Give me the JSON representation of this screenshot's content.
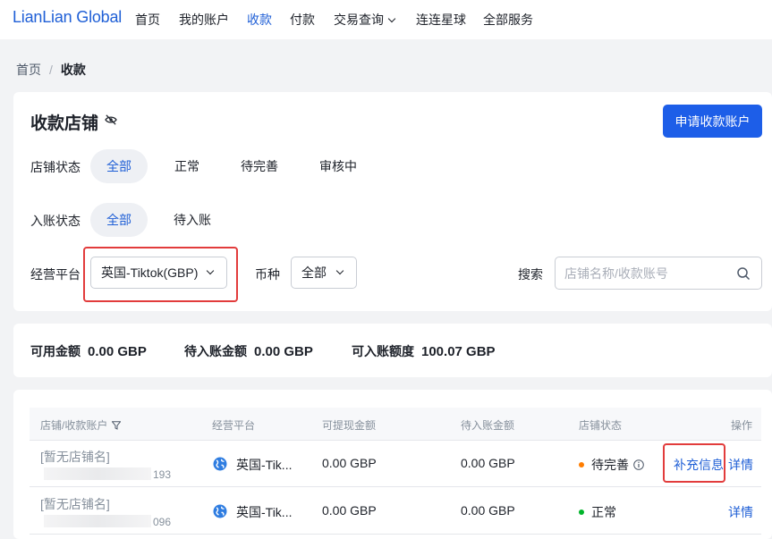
{
  "brand": {
    "logo_text": "LianLian Global",
    "color": "#1f5fd6"
  },
  "nav": {
    "items": [
      {
        "label": "首页"
      },
      {
        "label": "我的账户"
      },
      {
        "label": "收款",
        "active": true
      },
      {
        "label": "付款"
      },
      {
        "label": "交易查询",
        "has_dropdown": true
      },
      {
        "label": "连连星球"
      },
      {
        "label": "全部服务"
      }
    ]
  },
  "breadcrumb": {
    "root": "首页",
    "separator": "/",
    "current": "收款"
  },
  "page": {
    "title": "收款店铺",
    "title_icon": "eye-off-icon",
    "primary_button": "申请收款账户"
  },
  "filters": {
    "store_status": {
      "label": "店铺状态",
      "options": [
        "全部",
        "正常",
        "待完善",
        "审核中"
      ],
      "selected": "全部"
    },
    "receipt_status": {
      "label": "入账状态",
      "options": [
        "全部",
        "待入账"
      ],
      "selected": "全部"
    },
    "platform": {
      "label": "经营平台",
      "value": "英国-Tiktok(GBP)"
    },
    "currency": {
      "label": "币种",
      "value": "全部"
    },
    "search": {
      "label": "搜索",
      "placeholder": "店铺名称/收款账号",
      "icon": "search-icon"
    }
  },
  "balances": [
    {
      "label": "可用金额",
      "value": "0.00 GBP"
    },
    {
      "label": "待入账金额",
      "value": "0.00 GBP"
    },
    {
      "label": "可入账额度",
      "value": "100.07 GBP"
    }
  ],
  "table": {
    "headers": [
      "店铺/收款账户",
      "经营平台",
      "可提现金额",
      "待入账金额",
      "店铺状态",
      "操作"
    ],
    "rows": [
      {
        "store": "[暂无店铺名]",
        "account_suffix": "193",
        "platform": "英国-Tik...",
        "withdrawable": "0.00 GBP",
        "pending": "0.00 GBP",
        "status": "待完善",
        "status_color": "#ff7d00",
        "actions": [
          "补充信息",
          "详情"
        ]
      },
      {
        "store": "[暂无店铺名]",
        "account_suffix": "096",
        "platform": "英国-Tik...",
        "withdrawable": "0.00 GBP",
        "pending": "0.00 GBP",
        "status": "正常",
        "status_color": "#00b42a",
        "actions": [
          "详情"
        ]
      }
    ]
  },
  "colors": {
    "primary": "#1d5ee8",
    "highlight_box": "#e23c3c",
    "background": "#f2f3f5"
  }
}
